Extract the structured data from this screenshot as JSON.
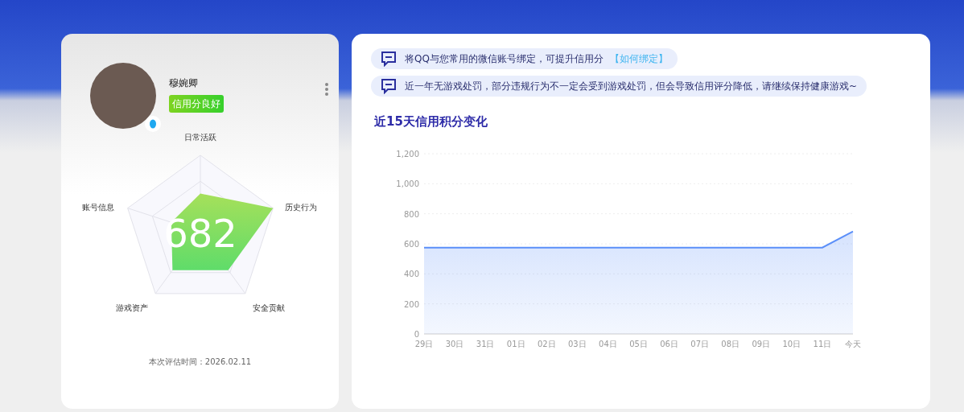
{
  "profile": {
    "name": "穆婉卿",
    "badge": "信用分良好",
    "score": "682",
    "radar_labels": [
      "日常活跃",
      "历史行为",
      "安全贡献",
      "游戏资产",
      "账号信息"
    ],
    "eval_time": "本次评估时间：2026.02.11"
  },
  "notices": [
    {
      "text": "将QQ与您常用的微信账号绑定，可提升信用分",
      "link": "【如何绑定】"
    },
    {
      "text": "近一年无游戏处罚，部分违规行为不一定会受到游戏处罚，但会导致信用评分降低，请继续保持健康游戏~"
    }
  ],
  "chart_title": "近15天信用积分变化",
  "chart_data": {
    "type": "area",
    "categories": [
      "29日",
      "30日",
      "31日",
      "01日",
      "02日",
      "03日",
      "04日",
      "05日",
      "06日",
      "07日",
      "08日",
      "09日",
      "10日",
      "11日",
      "今天"
    ],
    "grid": true,
    "series": [
      {
        "color": "#5b8ff9",
        "values": [
          575,
          575,
          575,
          575,
          575,
          575,
          575,
          575,
          575,
          575,
          575,
          575,
          575,
          575,
          682
        ]
      }
    ],
    "ylim": [
      0,
      1200
    ],
    "yticks": [
      0,
      {
        "value": 200,
        "label": "200"
      },
      {
        "value": 400,
        "label": "400"
      },
      {
        "value": 600,
        "label": "600"
      },
      {
        "value": 800,
        "label": "800"
      },
      {
        "value": 1000,
        "label": "1,000"
      },
      {
        "value": 1200,
        "label": "1,200"
      }
    ]
  }
}
